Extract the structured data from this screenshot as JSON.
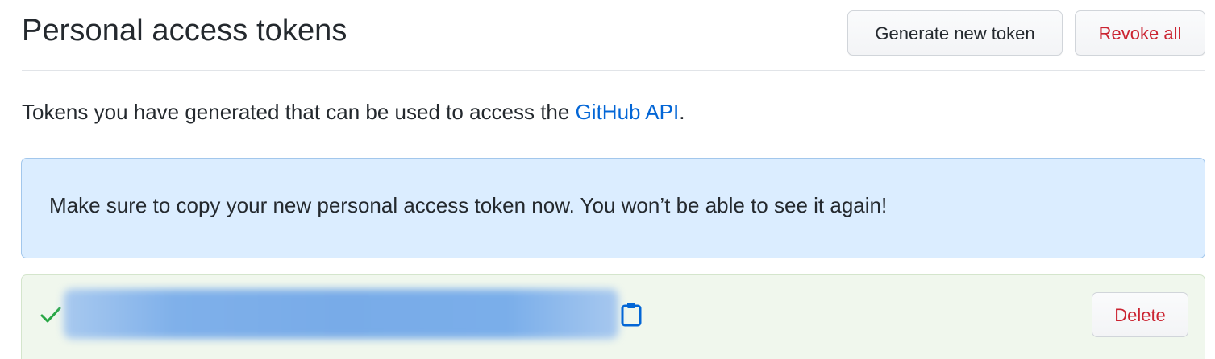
{
  "header": {
    "title": "Personal access tokens",
    "generate_label": "Generate new token",
    "revoke_label": "Revoke all"
  },
  "description": {
    "text_before": "Tokens you have generated that can be used to access the ",
    "link_text": "GitHub API",
    "text_after": "."
  },
  "flash": {
    "message": "Make sure to copy your new personal access token now. You won’t be able to see it again!"
  },
  "token": {
    "status_icon": "check-icon",
    "value": "",
    "copy_icon": "clipboard-icon",
    "delete_label": "Delete"
  },
  "colors": {
    "link": "#0366d6",
    "danger": "#cb2431",
    "flash_bg": "#dbedff",
    "token_bg": "#f0f7ed",
    "success": "#28a745"
  }
}
